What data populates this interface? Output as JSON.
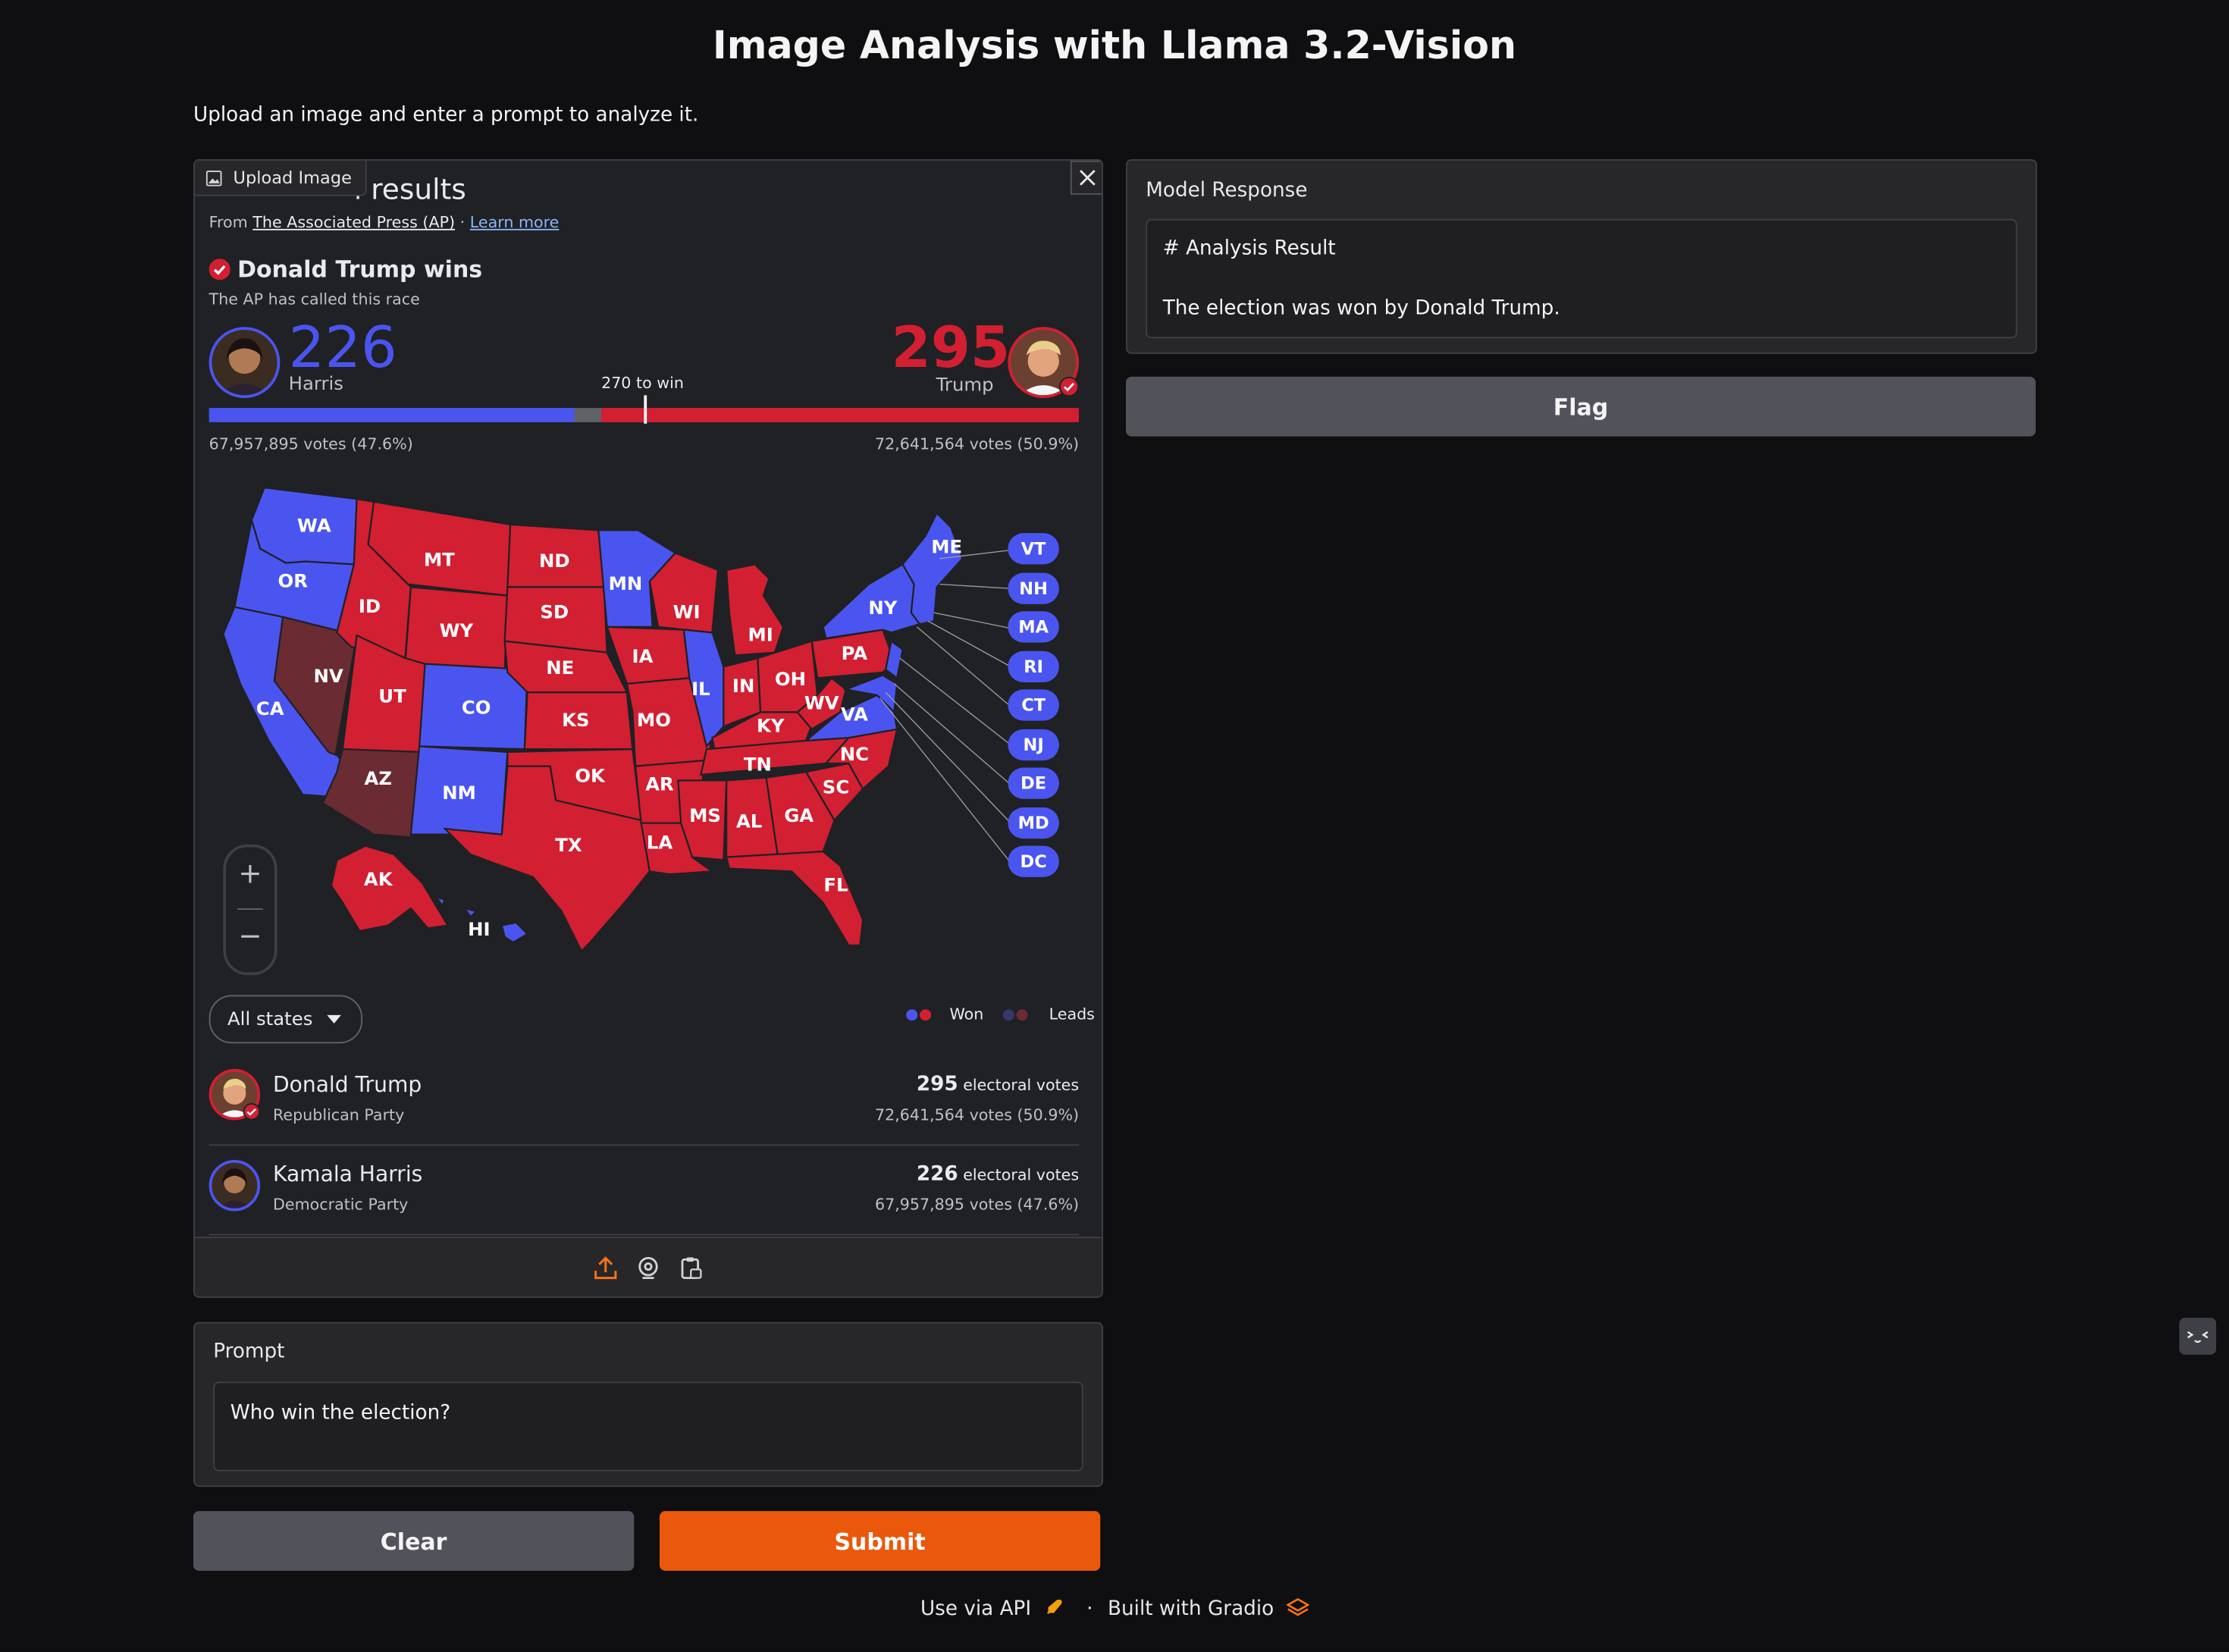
{
  "app": {
    "title": "Image Analysis with Llama 3.2-Vision",
    "description": "Upload an image and enter a prompt to analyze it."
  },
  "image_input": {
    "label": "Upload Image",
    "toolbar_icons": [
      "upload-icon",
      "webcam-icon",
      "clipboard-icon"
    ]
  },
  "screenshot": {
    "heading": "l results",
    "source_prefix": "From",
    "source_link": "The Associated Press (AP)",
    "separator": "·",
    "learn_more": "Learn more",
    "winner_text": "Donald Trump wins",
    "called_text": "The AP has called this race",
    "harris_ev": "226",
    "harris_label": "Harris",
    "trump_ev": "295",
    "trump_label": "Trump",
    "threshold": "270 to win",
    "harris_votes": "67,957,895 votes (47.6%)",
    "trump_votes": "72,641,564 votes (50.9%)",
    "filter": "All states",
    "legend_won": "Won",
    "legend_leads": "Leads",
    "zoom_in": "+",
    "zoom_out": "−",
    "candidates": [
      {
        "name": "Donald Trump",
        "party": "Republican Party",
        "ev": "295",
        "ev_suffix": "electoral votes",
        "votes": "72,641,564 votes (50.9%)"
      },
      {
        "name": "Kamala Harris",
        "party": "Democratic Party",
        "ev": "226",
        "ev_suffix": "electoral votes",
        "votes": "67,957,895 votes (47.6%)"
      }
    ],
    "east_labels": [
      "VT",
      "NH",
      "MA",
      "RI",
      "CT",
      "NJ",
      "DE",
      "MD",
      "DC"
    ],
    "colors": {
      "dem": "#4a55f0",
      "rep": "#d21f32",
      "rep_lead": "#6b2b33",
      "bar_gap": "#5f6368"
    },
    "ev_bar": {
      "dem_won": 226,
      "rep_won": 295,
      "total": 538
    }
  },
  "model_response": {
    "label": "Model Response",
    "line1": "# Analysis Result",
    "line2": "The election was won by Donald Trump."
  },
  "buttons": {
    "flag": "Flag",
    "clear": "Clear",
    "submit": "Submit"
  },
  "prompt": {
    "label": "Prompt",
    "value": "Who win the election?"
  },
  "footer": {
    "api": "Use via API",
    "dot": "·",
    "built": "Built with Gradio"
  }
}
